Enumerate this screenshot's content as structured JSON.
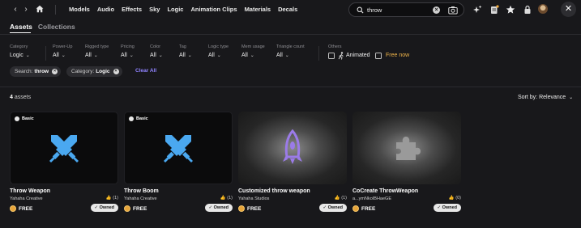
{
  "nav": {
    "back_icon": "chevron-left-icon",
    "forward_icon": "chevron-right-icon",
    "home_icon": "home-icon",
    "categories": [
      "Models",
      "Audio",
      "Effects",
      "Sky",
      "Logic",
      "Animation Clips",
      "Materials",
      "Decals"
    ]
  },
  "search": {
    "value": "throw",
    "placeholder": "Search"
  },
  "tabs": {
    "assets": "Assets",
    "collections": "Collections"
  },
  "filters": [
    {
      "label": "Category",
      "value": "Logic"
    },
    {
      "label": "Power-Up",
      "value": "All"
    },
    {
      "label": "Rigged type",
      "value": "All"
    },
    {
      "label": "Pricing",
      "value": "All"
    },
    {
      "label": "Color",
      "value": "All"
    },
    {
      "label": "Tag",
      "value": "All"
    },
    {
      "label": "Logic type",
      "value": "All"
    },
    {
      "label": "Mem usage",
      "value": "All"
    },
    {
      "label": "Triangle count",
      "value": "All"
    }
  ],
  "others": {
    "label": "Others",
    "animated": "Animated",
    "free_now": "Free now"
  },
  "chips": {
    "search_key": "Search:",
    "search_val": "throw",
    "category_key": "Category:",
    "category_val": "Logic",
    "clear_all": "Clear All"
  },
  "results": {
    "count": "4",
    "count_label": "assets",
    "sort": "Sort by: Relevance"
  },
  "cards": [
    {
      "title": "Throw Weapon",
      "author": "Yahaha Creative",
      "likes": "(1)",
      "price": "FREE",
      "owned": "Owned",
      "badge": "Basic"
    },
    {
      "title": "Throw Boom",
      "author": "Yahaha Creative",
      "likes": "(1)",
      "price": "FREE",
      "owned": "Owned",
      "badge": "Basic"
    },
    {
      "title": "Customized throw weapon",
      "author": "Yahaha Studios",
      "likes": "(1)",
      "price": "FREE",
      "owned": "Owned"
    },
    {
      "title": "CoCreate ThrowWeapon",
      "author": "a...ymNkoIBHaeGE",
      "likes": "(0)",
      "price": "FREE",
      "owned": "Owned"
    }
  ],
  "colors": {
    "background": "#18181b",
    "accent": "#8f83ff",
    "free_now": "#f0b54a",
    "weapon_blue": "#4aa8f0",
    "rocket_purple": "#9b7be8",
    "coin": "#e7a53a"
  }
}
